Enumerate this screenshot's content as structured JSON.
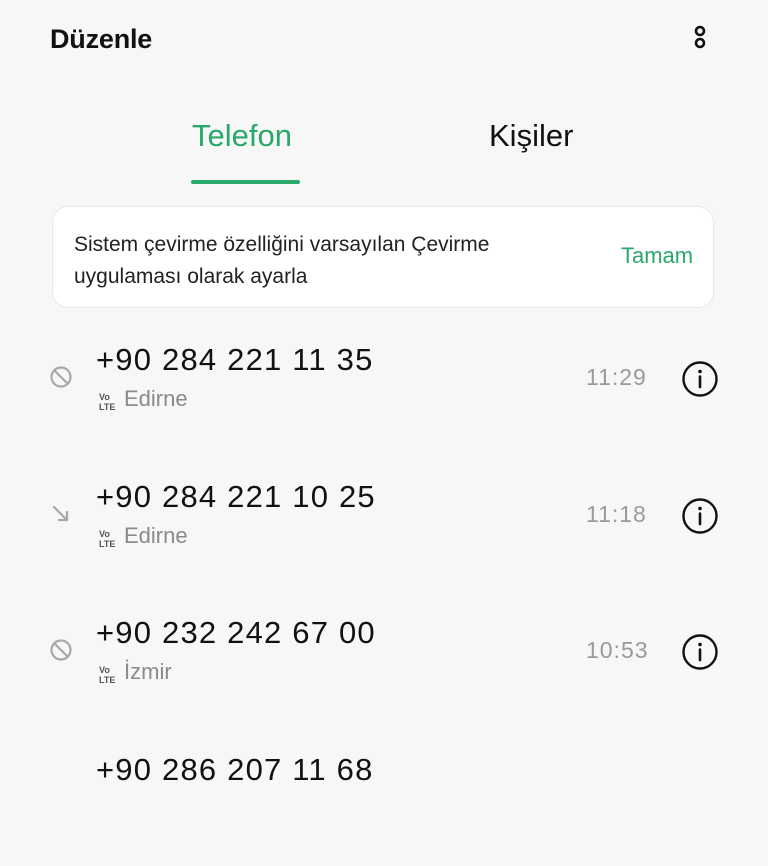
{
  "header": {
    "edit_label": "Düzenle",
    "more_icon": "more-vertical-icon"
  },
  "tabs": [
    {
      "label": "Telefon",
      "active": true
    },
    {
      "label": "Kişiler",
      "active": false
    }
  ],
  "banner": {
    "text": "Sistem çevirme özelliğini varsayılan Çevirme uygulaması olarak ayarla",
    "action_label": "Tamam"
  },
  "calls": [
    {
      "number": "+90 284 221 11 35",
      "network_badge_top": "Vo",
      "network_badge_bottom": "LTE",
      "location": "Edirne",
      "time": "11:29",
      "status_icon": "blocked-icon"
    },
    {
      "number": "+90 284 221 10 25",
      "network_badge_top": "Vo",
      "network_badge_bottom": "LTE",
      "location": "Edirne",
      "time": "11:18",
      "status_icon": "incoming-call-icon"
    },
    {
      "number": "+90 232 242 67 00",
      "network_badge_top": "Vo",
      "network_badge_bottom": "LTE",
      "location": "İzmir",
      "time": "10:53",
      "status_icon": "blocked-icon"
    },
    {
      "number": "+90 286 207 11 68",
      "network_badge_top": "",
      "network_badge_bottom": "",
      "location": "",
      "time": "",
      "status_icon": ""
    }
  ],
  "colors": {
    "accent": "#2aa86a",
    "background": "#f7f7f7",
    "secondary_text": "#8a8a8a"
  }
}
